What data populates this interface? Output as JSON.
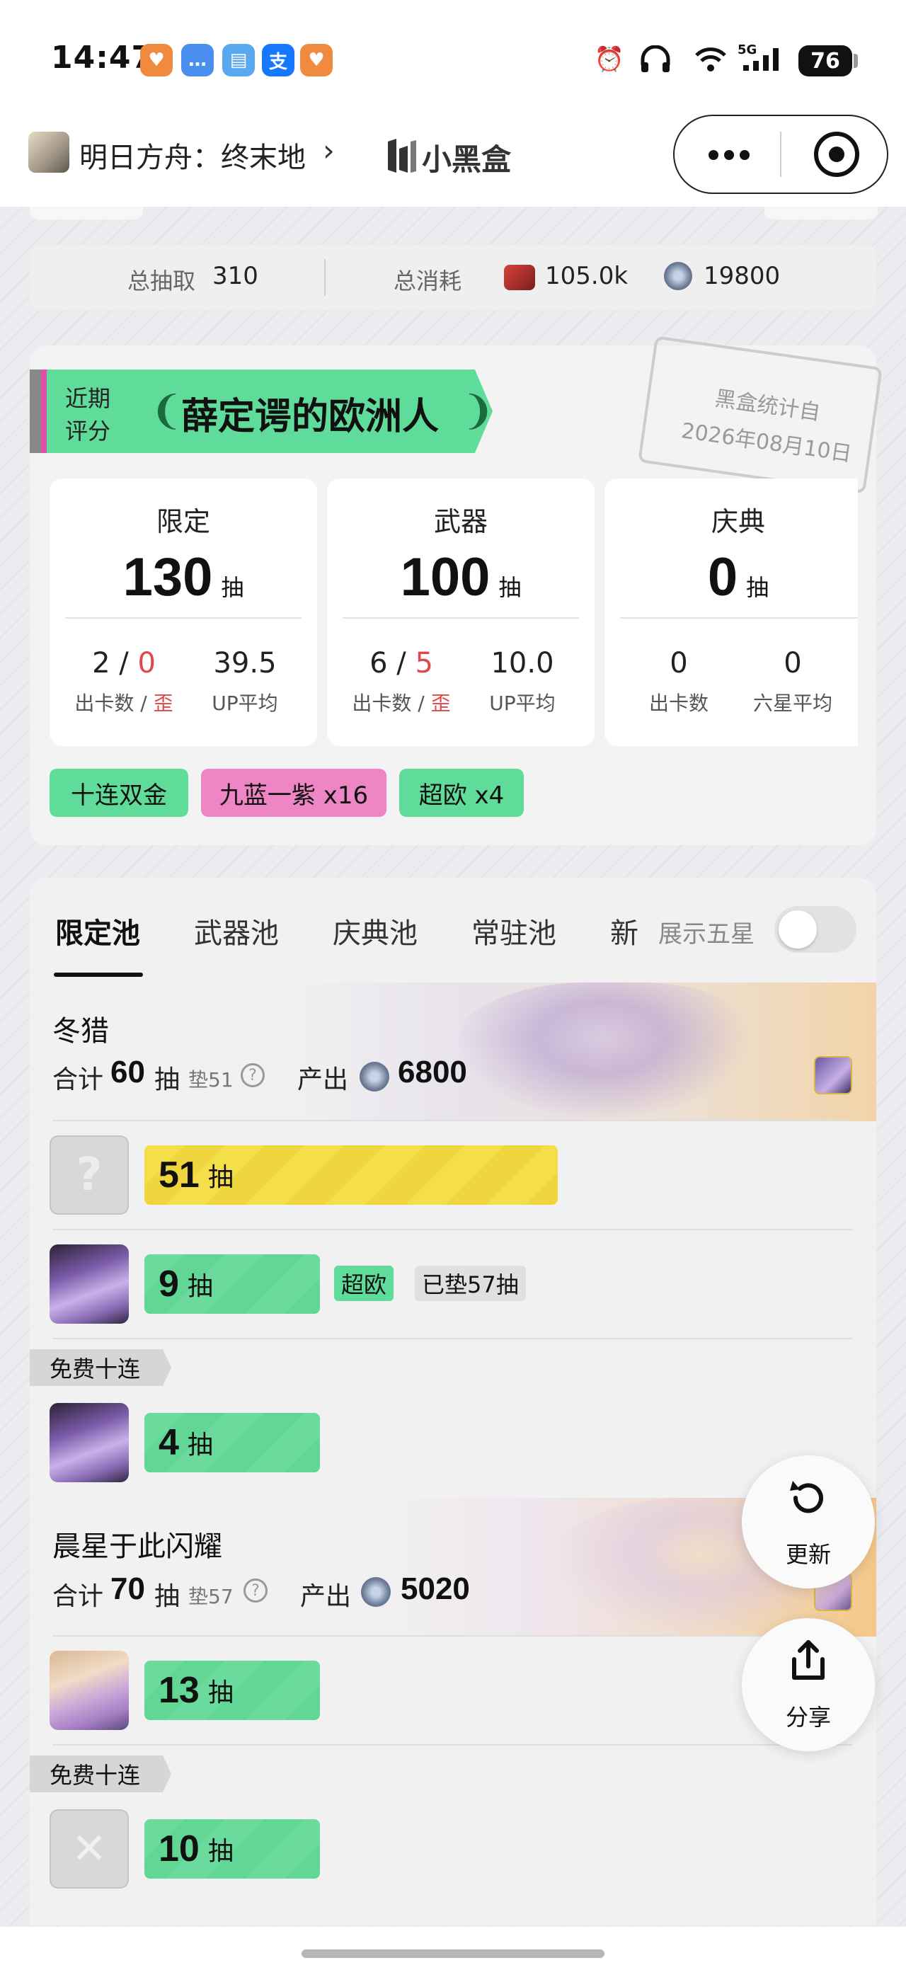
{
  "status_bar": {
    "time": "14:47",
    "battery": "76",
    "signal_label": "5G",
    "app_icons": [
      {
        "name": "heart-app-icon",
        "color": "#f08a3e",
        "glyph": "♥"
      },
      {
        "name": "chat-app-icon",
        "color": "#4a8ef0",
        "glyph": "…"
      },
      {
        "name": "book-app-icon",
        "color": "#5aa8f0",
        "glyph": "▤"
      },
      {
        "name": "alipay-app-icon",
        "color": "#1677ff",
        "glyph": "支"
      },
      {
        "name": "heart-app-icon-2",
        "color": "#f08a3e",
        "glyph": "♥"
      }
    ]
  },
  "nav": {
    "game_title": "明日方舟：终末地",
    "chevron": "›",
    "brand": "小黑盒"
  },
  "summary": {
    "total_pulls_label": "总抽取",
    "total_pulls_value": "310",
    "total_cost_label": "总消耗",
    "cost_resource_1": "105.0k",
    "cost_resource_2": "19800"
  },
  "rating": {
    "label_line1": "近期",
    "label_line2": "评分",
    "title": "薛定谔的欧洲人",
    "stamp_line1": "黑盒统计自",
    "stamp_line2": "2026年08月10日"
  },
  "stats": [
    {
      "name": "限定",
      "count": "130",
      "unit": "抽",
      "left_value_a": "2",
      "left_value_sep": " / ",
      "left_value_b": "0",
      "left_label_a": "出卡数 / ",
      "left_label_b": "歪",
      "right_value": "39.5",
      "right_label": "UP平均"
    },
    {
      "name": "武器",
      "count": "100",
      "unit": "抽",
      "left_value_a": "6",
      "left_value_sep": " / ",
      "left_value_b": "5",
      "left_label_a": "出卡数 / ",
      "left_label_b": "歪",
      "right_value": "10.0",
      "right_label": "UP平均"
    },
    {
      "name": "庆典",
      "count": "0",
      "unit": "抽",
      "left_value_a": "0",
      "left_label_a": "出卡数",
      "right_value": "0",
      "right_label": "六星平均"
    }
  ],
  "chips": [
    "十连双金",
    "九蓝一紫 x16",
    "超欧 x4"
  ],
  "colors": {
    "accent_green": "#5fdc9a",
    "chip_pink": "#ee86c6",
    "bar_yellow": "#f4de4a",
    "warn_red": "#e04848"
  },
  "tabs": [
    "限定池",
    "武器池",
    "庆典池",
    "常驻池",
    "新"
  ],
  "toggle_label": "展示五星",
  "pools": [
    {
      "name": "冬猎",
      "total_label": "合计",
      "total": "60",
      "unit": "抽",
      "pity": "垫51",
      "output_label": "产出",
      "output": "6800",
      "rows": [
        {
          "count": "51",
          "unit": "抽"
        },
        {
          "count": "9",
          "unit": "抽",
          "tag": "超欧",
          "pity_tag": "已垫57抽"
        }
      ],
      "free_ribbon": "免费十连",
      "free_rows": [
        {
          "count": "4",
          "unit": "抽"
        }
      ]
    },
    {
      "name": "晨星于此闪耀",
      "total_label": "合计",
      "total": "70",
      "unit": "抽",
      "pity": "垫57",
      "output_label": "产出",
      "output": "5020",
      "rows": [
        {
          "count": "13",
          "unit": "抽"
        }
      ],
      "free_ribbon": "免费十连",
      "free_rows": [
        {
          "count": "10",
          "unit": "抽"
        }
      ]
    }
  ],
  "fab": {
    "refresh_label": "更新",
    "share_label": "分享"
  }
}
